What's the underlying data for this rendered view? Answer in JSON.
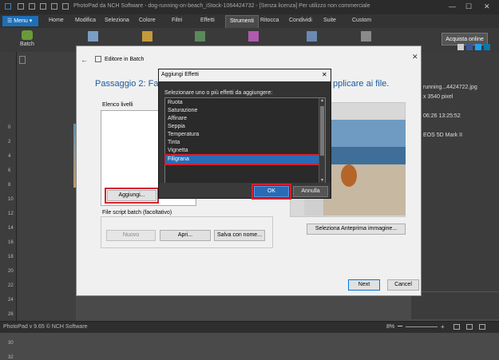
{
  "window": {
    "title": "PhotoPad da NCH Software - dog-running-on-beach_iStock-1064424732 - [Senza licenza] Per utilizzo non commerciale",
    "controls": [
      "minimize-icon",
      "maximize-icon",
      "close-icon"
    ]
  },
  "menu": {
    "button_label": "Menu",
    "tabs": [
      "Home",
      "Modifica",
      "Seleziona",
      "Colore",
      "Filtri",
      "Effetti",
      "Strumenti",
      "Ritocca",
      "Condividi",
      "Suite",
      "Custom"
    ],
    "active_tab": "Strumenti"
  },
  "toolbar": {
    "batch_label": "Batch",
    "purchase_label": "Acquista online"
  },
  "ruler": {
    "ticks": [
      "0",
      "2",
      "4",
      "6",
      "8",
      "10",
      "12",
      "14",
      "16",
      "18",
      "20",
      "22",
      "24",
      "26",
      "28",
      "30",
      "32"
    ]
  },
  "right_panel": {
    "filename": "running...4424722.jpg",
    "dimensions": "x 3540 pixel",
    "date": "06:26 13:25:52",
    "camera": "EOS 5D Mark II"
  },
  "batch_dialog": {
    "header": "Editore in Batch",
    "step_left": "Passaggio 2: Fai cli",
    "step_right": "pplicare ai file.",
    "layers_label": "Elenco livelli",
    "add_button": "Aggiungi...",
    "script_label": "File script batch (facoltativo)",
    "new_button": "Nuovo",
    "open_button": "Apri...",
    "save_as_button": "Salva con nome...",
    "preview_button": "Seleziona Anteprima immagine...",
    "next_button": "Next",
    "cancel_button": "Cancel"
  },
  "effects_modal": {
    "title": "Aggiungi Effetti",
    "instruction": "Selezionare uno o più effetti da aggiungere:",
    "effects": [
      "Ruota",
      "Saturazione",
      "Affinare",
      "Seppia",
      "Temperatura",
      "Tinta",
      "Vignetta",
      "Filigrana"
    ],
    "selected": "Filigrana",
    "ok_button": "OK",
    "cancel_button": "Annulla"
  },
  "status_bar": {
    "text": "PhotoPad v 9.65 © NCH Software",
    "zoom": "8%"
  },
  "colors": {
    "accent": "#1e6fb8",
    "highlight": "#d42030",
    "selection": "#2a6bb5"
  }
}
